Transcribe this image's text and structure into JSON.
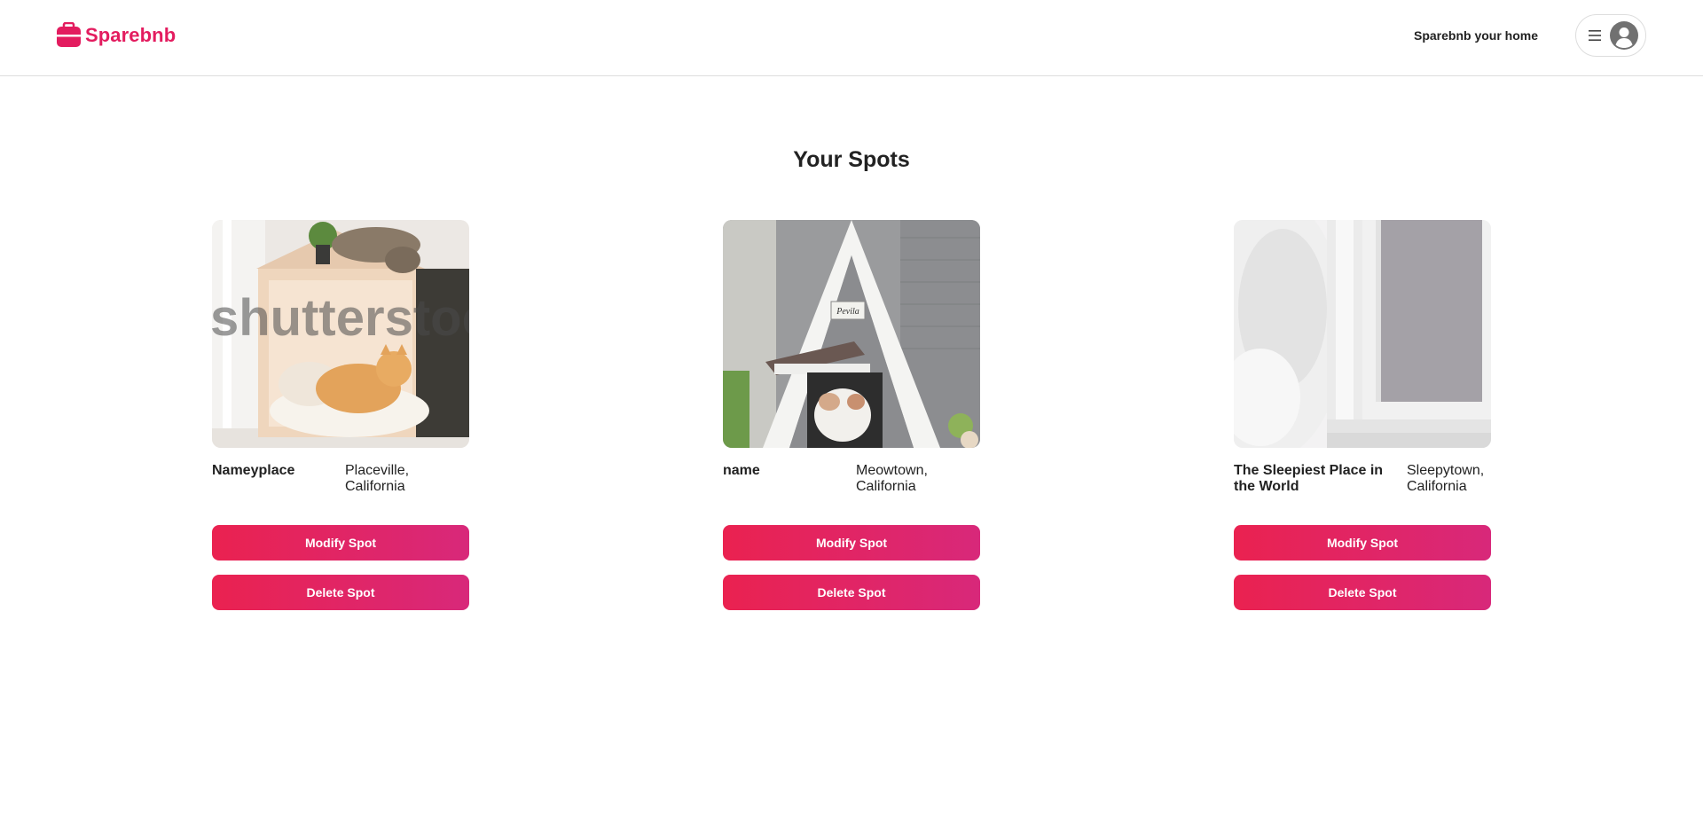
{
  "header": {
    "logo_text": "Sparebnb",
    "host_link": "Sparebnb your home",
    "menu_icon": "hamburger-menu-icon",
    "avatar_icon": "user-circle-icon",
    "brand_color": "#e31c5f"
  },
  "main": {
    "title": "Your Spots",
    "spots": [
      {
        "name": "Nameyplace",
        "location": "Placeville, California",
        "image_watermark": "shutterstock",
        "modify_label": "Modify Spot",
        "delete_label": "Delete Spot"
      },
      {
        "name": "name",
        "location": "Meowtown, California",
        "image_sign": "Pevila",
        "modify_label": "Modify Spot",
        "delete_label": "Delete Spot"
      },
      {
        "name": "The Sleepiest Place in the World",
        "location": "Sleepytown, California",
        "modify_label": "Modify Spot",
        "delete_label": "Delete Spot"
      }
    ]
  },
  "colors": {
    "button_gradient_start": "#ea2250",
    "button_gradient_end": "#d8287a",
    "border": "#dddddd",
    "text": "#222222"
  }
}
